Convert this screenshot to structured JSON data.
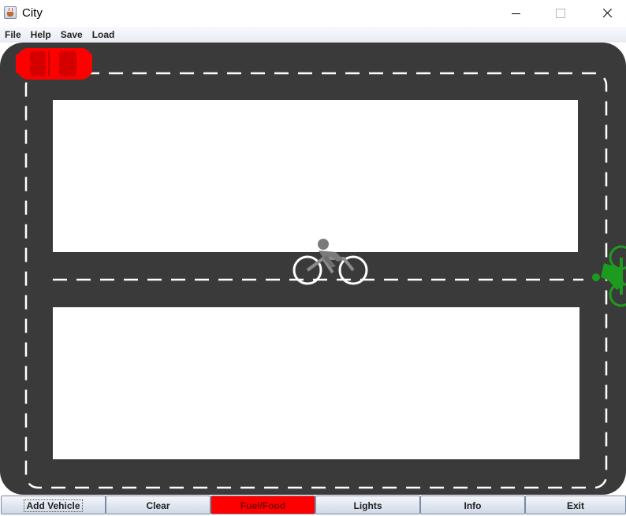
{
  "window": {
    "title": "City"
  },
  "menu": {
    "items": [
      {
        "label": "File"
      },
      {
        "label": "Help"
      },
      {
        "label": "Save"
      },
      {
        "label": "Load"
      }
    ]
  },
  "buttons": [
    {
      "label": "Add Vehicle",
      "focused": true
    },
    {
      "label": "Clear"
    },
    {
      "label": "Fuel/Food",
      "highlighted": true,
      "color": "#ff0000"
    },
    {
      "label": "Lights"
    },
    {
      "label": "Info"
    },
    {
      "label": "Exit"
    }
  ],
  "scene": {
    "road_color": "#3a3a3a",
    "lane_marking_color": "#ffffff",
    "vehicles": [
      {
        "type": "car",
        "color": "#ff0000"
      },
      {
        "type": "bicycle",
        "color": "#8c8c8c"
      },
      {
        "type": "bicycle",
        "color": "#1e9a1e"
      }
    ]
  }
}
